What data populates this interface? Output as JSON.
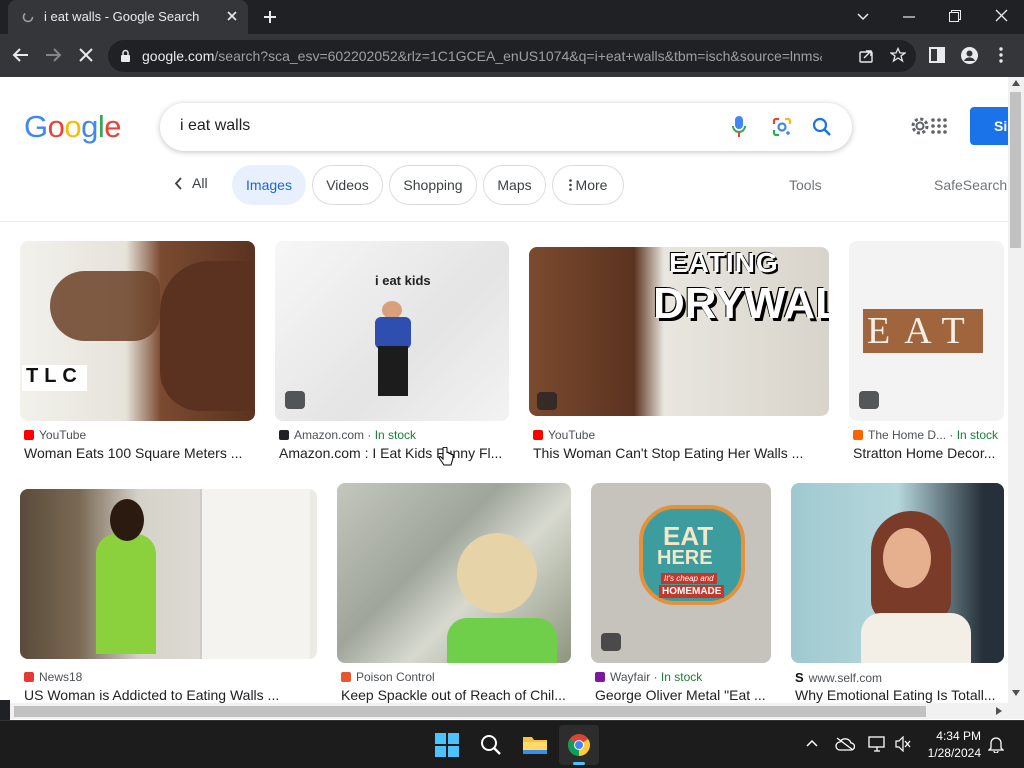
{
  "browser": {
    "tab_title": "i eat walls - Google Search",
    "url_host": "google.com",
    "url_path": "/search?sca_esv=602202052&rlz=1C1GCEA_enUS1074&q=i+eat+walls&tbm=isch&source=lnms&sa..."
  },
  "search": {
    "logo": [
      "G",
      "o",
      "o",
      "g",
      "l",
      "e"
    ],
    "logo_colors": [
      "#4285f4",
      "#ea4335",
      "#fbbc05",
      "#4285f4",
      "#34a853",
      "#ea4335"
    ],
    "query": "i eat walls",
    "signin_label": "Si"
  },
  "filters": {
    "back_label": "All",
    "chips": [
      "Images",
      "Videos",
      "Shopping",
      "Maps",
      "More"
    ],
    "active": "Images",
    "tools_label": "Tools",
    "safesearch_label": "SafeSearch"
  },
  "results": [
    {
      "source": "YouTube",
      "stock": "",
      "title": "Woman Eats 100 Square Meters ...",
      "favicon_color": "#ff0000"
    },
    {
      "source": "Amazon.com",
      "stock": "In stock",
      "title": "Amazon.com : I Eat Kids Funny Fl...",
      "favicon_color": "#202124",
      "image_text": "i eat kids"
    },
    {
      "source": "YouTube",
      "stock": "",
      "title": "This Woman Can't Stop Eating Her Walls ...",
      "favicon_color": "#ff0000",
      "image_text_1": "EATING",
      "image_text_2": "DRYWALL"
    },
    {
      "source": "The Home D...",
      "stock": "In stock",
      "title": "Stratton Home Decor...",
      "favicon_color": "#f96302",
      "image_text": "EAT"
    },
    {
      "source": "News18",
      "stock": "",
      "title": "US Woman is Addicted to Eating Walls ...",
      "favicon_color": "#e53935"
    },
    {
      "source": "Poison Control",
      "stock": "",
      "title": "Keep Spackle out of Reach of Chil...",
      "favicon_color": "#e8572b"
    },
    {
      "source": "Wayfair",
      "stock": "In stock",
      "title": "George Oliver Metal \"Eat ...",
      "favicon_color": "#7b189f",
      "image_text_1": "EAT",
      "image_text_2": "HERE",
      "image_text_3": "It's cheap and",
      "image_text_4": "HOMEMADE"
    },
    {
      "source": "www.self.com",
      "stock": "",
      "title": "Why Emotional Eating Is Totall...",
      "favicon_color": "#111111"
    }
  ],
  "image_overlays": {
    "tlc": "TLC"
  },
  "taskbar": {
    "time": "4:34 PM",
    "date": "1/28/2024"
  },
  "colors": {
    "chrome_dark": "#202124",
    "chrome_toolbar": "#35363a",
    "google_blue": "#1a73e8",
    "chip_active_bg": "#e8f0fe",
    "in_stock_green": "#188038"
  }
}
